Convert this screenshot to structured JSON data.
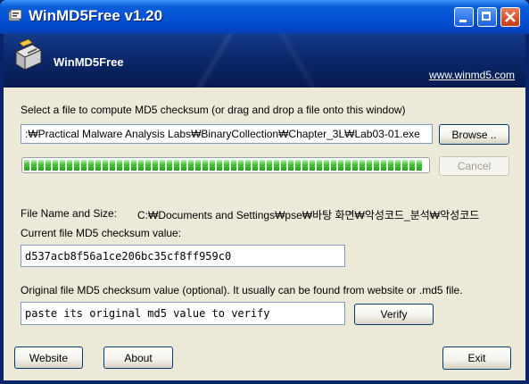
{
  "window": {
    "title": "WinMD5Free v1.20"
  },
  "banner": {
    "app_name": "WinMD5Free",
    "link": "www.winmd5.com"
  },
  "file_select": {
    "instruction": "Select a file to compute MD5 checksum (or drag and drop a file onto this window)",
    "path_value": ":₩Practical Malware Analysis Labs₩BinaryCollection₩Chapter_3L₩Lab03-01.exe",
    "browse_label": "Browse ..",
    "cancel_label": "Cancel"
  },
  "progress": {
    "fraction": 1.0
  },
  "info": {
    "name_size_label": "File Name and Size:",
    "name_size_value": "C:₩Documents and Settings₩pse₩바탕 화면₩악성코드_분석₩악성코드",
    "current_md5_label": "Current file MD5 checksum value:",
    "current_md5_value": "d537acb8f56a1ce206bc35cf8ff959c0",
    "original_md5_label": "Original file MD5 checksum value (optional). It usually can be found from website or .md5 file.",
    "original_md5_value": "paste its original md5 value to verify",
    "verify_label": "Verify"
  },
  "footer": {
    "website_label": "Website",
    "about_label": "About",
    "exit_label": "Exit"
  }
}
